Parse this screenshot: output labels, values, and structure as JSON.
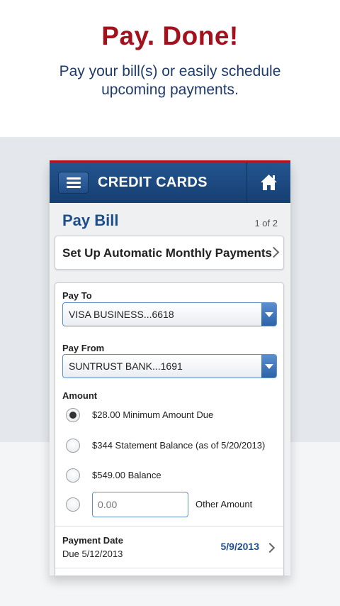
{
  "hero": {
    "title": "Pay. Done!",
    "subtitle": "Pay your bill(s) or easily schedule upcoming payments."
  },
  "app": {
    "header_title": "CREDIT CARDS",
    "menu_icon": "hamburger-menu-icon",
    "home_icon": "home-icon",
    "accent_red": "#b4121f",
    "header_blue": "#1c4b82"
  },
  "page": {
    "title": "Pay Bill",
    "step": "1 of 2"
  },
  "auto_payments": {
    "label": "Set Up Automatic Monthly Payments"
  },
  "form": {
    "pay_to_label": "Pay To",
    "pay_to_value": "VISA BUSINESS...6618",
    "pay_from_label": "Pay From",
    "pay_from_value": "SUNTRUST BANK...1691",
    "amount_label": "Amount",
    "amount_options": [
      {
        "label": "$28.00 Minimum Amount Due",
        "selected": true
      },
      {
        "label": "$344 Statement Balance (as of 5/20/2013)",
        "selected": false
      },
      {
        "label": "$549.00 Balance",
        "selected": false
      }
    ],
    "other_amount_placeholder": "0.00",
    "other_amount_label": "Other Amount",
    "payment_date_label": "Payment Date",
    "due_text": "Due 5/12/2013",
    "payment_date_value": "5/9/2013"
  }
}
